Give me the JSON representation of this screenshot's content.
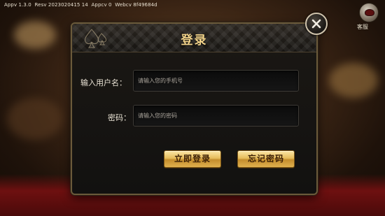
{
  "version_bar": {
    "appv": "Appv 1.3.0",
    "resv": "Resv 2023020415 14",
    "appcv": "Appcv 0",
    "webcv": "Webcv 8f49684d"
  },
  "customer_service": {
    "label": "客服",
    "icon": "customer-service-icon"
  },
  "dialog": {
    "title": "登录",
    "username": {
      "label": "输入用户名：",
      "placeholder": "请输入您的手机号"
    },
    "password": {
      "label": "密码：",
      "placeholder": "请输入您的密码"
    },
    "login_button": "立即登录",
    "forgot_button": "忘记密码",
    "close_icon": "close-icon"
  },
  "colors": {
    "title_gold": "#f2d38a",
    "button_gold": "#e6bc5b",
    "panel_bg": "#171512",
    "border": "#6b5a3a"
  }
}
